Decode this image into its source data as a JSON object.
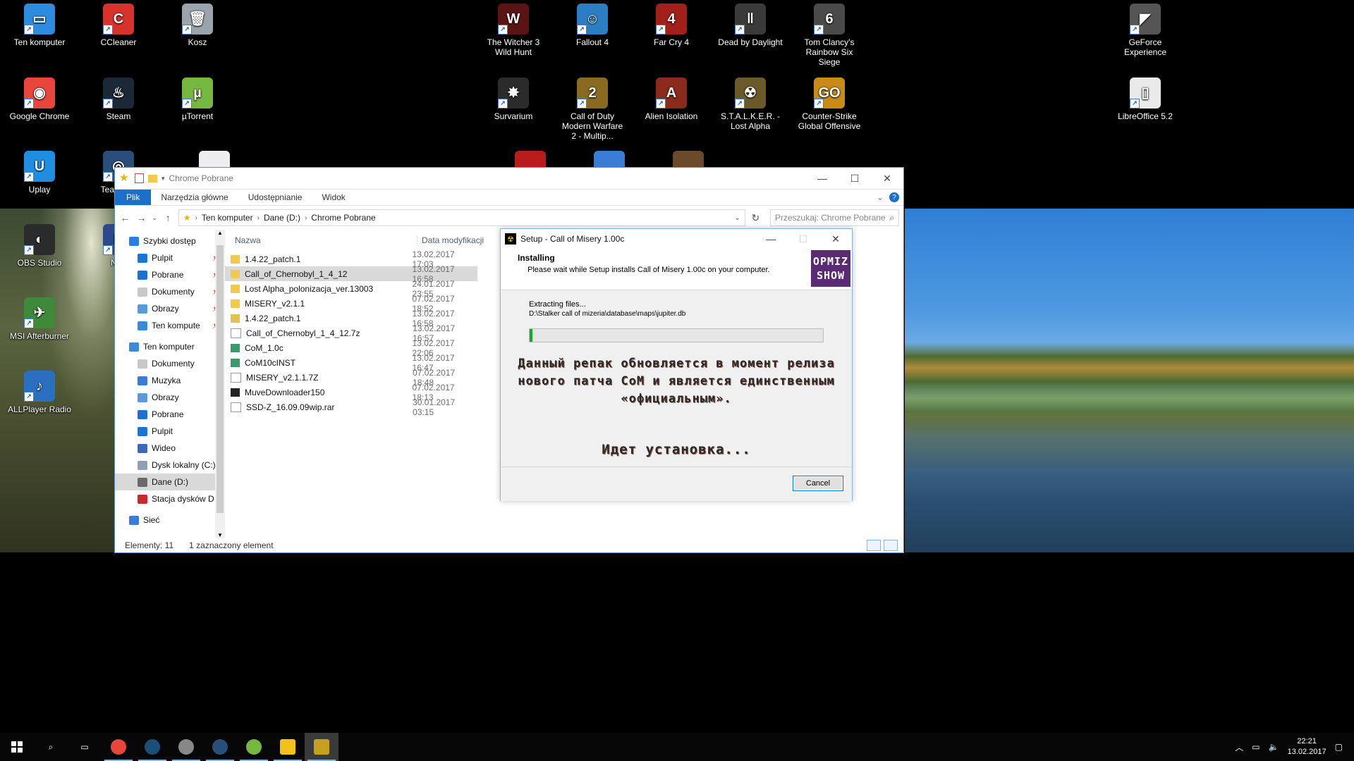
{
  "desktop": {
    "icons": [
      {
        "label": "Ten komputer",
        "color": "#2d8be0",
        "glyph": "▭"
      },
      {
        "label": "CCleaner",
        "color": "#d8322c",
        "glyph": "C"
      },
      {
        "label": "Kosz",
        "color": "#9aa4ad",
        "glyph": "🗑"
      },
      {
        "label": "Google Chrome",
        "color": "#e8453c",
        "glyph": "◉"
      },
      {
        "label": "Steam",
        "color": "#1b2838",
        "glyph": "♨"
      },
      {
        "label": "µTorrent",
        "color": "#76b83f",
        "glyph": "µ"
      },
      {
        "label": "Uplay",
        "color": "#1f8ee0",
        "glyph": "U"
      },
      {
        "label": "TeamSpe",
        "color": "#2a4e7a",
        "glyph": "◎"
      },
      {
        "label": "OBS Studio",
        "color": "#2b2b2b",
        "glyph": "◐"
      },
      {
        "label": "Nap",
        "color": "#2c4a8a",
        "glyph": "N"
      },
      {
        "label": "MSI Afterburner",
        "color": "#3f8a3a",
        "glyph": "✈"
      },
      {
        "label": "ALLPlayer Radio",
        "color": "#2b6fc0",
        "glyph": "♪"
      },
      {
        "label": "The Witcher 3 Wild Hunt",
        "color": "#5b1414",
        "glyph": "W"
      },
      {
        "label": "Fallout 4",
        "color": "#2b7ec4",
        "glyph": "☺"
      },
      {
        "label": "Far Cry 4",
        "color": "#a3201a",
        "glyph": "4"
      },
      {
        "label": "Dead by Daylight",
        "color": "#3a3a3a",
        "glyph": "‖"
      },
      {
        "label": "Tom Clancy's Rainbow Six Siege",
        "color": "#4a4a4a",
        "glyph": "6"
      },
      {
        "label": "GeForce Experience",
        "color": "#555",
        "glyph": "◤"
      },
      {
        "label": "Survarium",
        "color": "#2b2b2b",
        "glyph": "✸"
      },
      {
        "label": "Call of Duty Modern Warfare 2 - Multip...",
        "color": "#8a6a20",
        "glyph": "2"
      },
      {
        "label": "Alien Isolation",
        "color": "#8a2a1a",
        "glyph": "A"
      },
      {
        "label": "S.T.A.L.K.E.R. - Lost Alpha",
        "color": "#6a5a2a",
        "glyph": "☢"
      },
      {
        "label": "Counter-Strike Global Offensive",
        "color": "#c98a16",
        "glyph": "GO"
      },
      {
        "label": "LibreOffice 5.2",
        "color": "#eaeaea",
        "glyph": "▯"
      }
    ]
  },
  "explorer": {
    "title": "Chrome Pobrane",
    "ribbon_tabs": [
      "Plik",
      "Narzędzia główne",
      "Udostępnianie",
      "Widok"
    ],
    "breadcrumb": [
      "Ten komputer",
      "Dane (D:)",
      "Chrome Pobrane"
    ],
    "search_placeholder": "Przeszukaj: Chrome Pobrane",
    "nav": [
      {
        "label": "Szybki dostęp",
        "color": "#2a7de1",
        "sub": false,
        "pin": false,
        "sel": false
      },
      {
        "label": "Pulpit",
        "color": "#1b76d3",
        "sub": true,
        "pin": true,
        "sel": false
      },
      {
        "label": "Pobrane",
        "color": "#1f6fd0",
        "sub": true,
        "pin": true,
        "sel": false
      },
      {
        "label": "Dokumenty",
        "color": "#c8c8c8",
        "sub": true,
        "pin": true,
        "sel": false
      },
      {
        "label": "Obrazy",
        "color": "#5a9ad8",
        "sub": true,
        "pin": true,
        "sel": false
      },
      {
        "label": "Ten kompute",
        "color": "#3a8ad8",
        "sub": true,
        "pin": true,
        "sel": false
      },
      {
        "label": "Ten komputer",
        "color": "#3a8ad8",
        "sub": false,
        "pin": false,
        "sel": false
      },
      {
        "label": "Dokumenty",
        "color": "#c8c8c8",
        "sub": true,
        "pin": false,
        "sel": false
      },
      {
        "label": "Muzyka",
        "color": "#3a7bd5",
        "sub": true,
        "pin": false,
        "sel": false
      },
      {
        "label": "Obrazy",
        "color": "#5a9ad8",
        "sub": true,
        "pin": false,
        "sel": false
      },
      {
        "label": "Pobrane",
        "color": "#1f6fd0",
        "sub": true,
        "pin": false,
        "sel": false
      },
      {
        "label": "Pulpit",
        "color": "#1b76d3",
        "sub": true,
        "pin": false,
        "sel": false
      },
      {
        "label": "Wideo",
        "color": "#3a6ab5",
        "sub": true,
        "pin": false,
        "sel": false
      },
      {
        "label": "Dysk lokalny (C:)",
        "color": "#8fa0b0",
        "sub": true,
        "pin": false,
        "sel": false
      },
      {
        "label": "Dane (D:)",
        "color": "#6a6a6a",
        "sub": true,
        "pin": false,
        "sel": true
      },
      {
        "label": "Stacja dysków D",
        "color": "#c82a2a",
        "sub": true,
        "pin": false,
        "sel": false
      },
      {
        "label": "Sieć",
        "color": "#3a7bd5",
        "sub": false,
        "pin": false,
        "sel": false
      }
    ],
    "columns": {
      "name": "Nazwa",
      "date": "Data modyfikacji"
    },
    "files": [
      {
        "name": "1.4.22_patch.1",
        "date": "13.02.2017 17:03",
        "type": "folder",
        "sel": false
      },
      {
        "name": "Call_of_Chernobyl_1_4_12",
        "date": "13.02.2017 16:58",
        "type": "folder",
        "sel": true
      },
      {
        "name": "Lost Alpha_polonizacja_ver.13003",
        "date": "24.01.2017 23:55",
        "type": "folder",
        "sel": false
      },
      {
        "name": "MISERY_v2.1.1",
        "date": "07.02.2017 18:52",
        "type": "folder",
        "sel": false
      },
      {
        "name": "1.4.22_patch.1",
        "date": "13.02.2017 16:58",
        "type": "zip",
        "sel": false
      },
      {
        "name": "Call_of_Chernobyl_1_4_12.7z",
        "date": "13.02.2017 16:57",
        "type": "file",
        "sel": false
      },
      {
        "name": "CoM_1.0c",
        "date": "13.02.2017 22:06",
        "type": "exe",
        "sel": false
      },
      {
        "name": "CoM10cINST",
        "date": "13.02.2017 16:47",
        "type": "exe",
        "sel": false
      },
      {
        "name": "MISERY_v2.1.1.7Z",
        "date": "07.02.2017 18:48",
        "type": "file",
        "sel": false
      },
      {
        "name": "MuveDownloader150",
        "date": "07.02.2017 18:13",
        "type": "app",
        "sel": false
      },
      {
        "name": "SSD-Z_16.09.09wip.rar",
        "date": "30.01.2017 03:15",
        "type": "file",
        "sel": false
      }
    ],
    "status": {
      "count": "Elementy: 11",
      "selected": "1 zaznaczony element"
    }
  },
  "setup": {
    "title": "Setup - Call of Misery 1.00c",
    "heading": "Installing",
    "subheading": "Please wait while Setup installs Call of Misery 1.00c on your computer.",
    "logo_line1": "OPMIZ",
    "logo_line2": "SHOW",
    "extracting": "Extracting files...",
    "path": "D:\\Stalker call of mizeria\\database\\maps\\jupiter.db",
    "progress": 0.01,
    "ru_message": "Данный репак обновляется в момент релиза нового патча CoM и является единственным «официальным».",
    "ru_installing": "Идет установка...",
    "cancel": "Cancel"
  },
  "taskbar": {
    "apps": [
      {
        "name": "chrome",
        "color": "#e8453c",
        "active": false,
        "open": true
      },
      {
        "name": "steam",
        "color": "#1b4f7a",
        "active": false,
        "open": true
      },
      {
        "name": "teamspeak",
        "color": "#888",
        "active": false,
        "open": true
      },
      {
        "name": "teamspeak-alt",
        "color": "#2a4e7a",
        "active": false,
        "open": true
      },
      {
        "name": "utorrent",
        "color": "#76b83f",
        "active": false,
        "open": true
      },
      {
        "name": "file-explorer",
        "color": "#f2c21a",
        "active": false,
        "open": true
      },
      {
        "name": "setup-call-of-misery",
        "color": "#c8a020",
        "active": true,
        "open": true
      }
    ],
    "time": "22:21",
    "date": "13.02.2017"
  }
}
